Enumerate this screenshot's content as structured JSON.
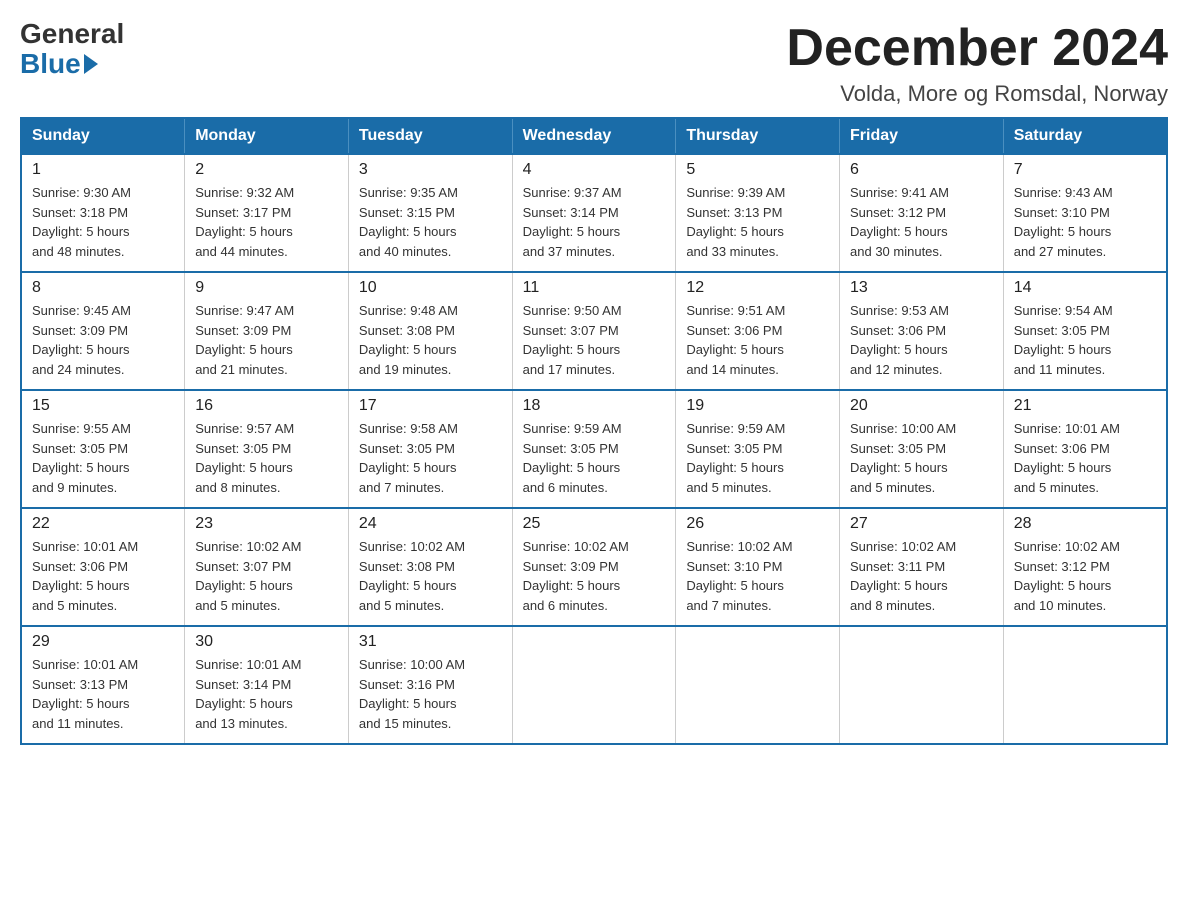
{
  "logo": {
    "general": "General",
    "blue": "Blue"
  },
  "title": "December 2024",
  "location": "Volda, More og Romsdal, Norway",
  "headers": [
    "Sunday",
    "Monday",
    "Tuesday",
    "Wednesday",
    "Thursday",
    "Friday",
    "Saturday"
  ],
  "weeks": [
    [
      {
        "day": "1",
        "info": "Sunrise: 9:30 AM\nSunset: 3:18 PM\nDaylight: 5 hours\nand 48 minutes."
      },
      {
        "day": "2",
        "info": "Sunrise: 9:32 AM\nSunset: 3:17 PM\nDaylight: 5 hours\nand 44 minutes."
      },
      {
        "day": "3",
        "info": "Sunrise: 9:35 AM\nSunset: 3:15 PM\nDaylight: 5 hours\nand 40 minutes."
      },
      {
        "day": "4",
        "info": "Sunrise: 9:37 AM\nSunset: 3:14 PM\nDaylight: 5 hours\nand 37 minutes."
      },
      {
        "day": "5",
        "info": "Sunrise: 9:39 AM\nSunset: 3:13 PM\nDaylight: 5 hours\nand 33 minutes."
      },
      {
        "day": "6",
        "info": "Sunrise: 9:41 AM\nSunset: 3:12 PM\nDaylight: 5 hours\nand 30 minutes."
      },
      {
        "day": "7",
        "info": "Sunrise: 9:43 AM\nSunset: 3:10 PM\nDaylight: 5 hours\nand 27 minutes."
      }
    ],
    [
      {
        "day": "8",
        "info": "Sunrise: 9:45 AM\nSunset: 3:09 PM\nDaylight: 5 hours\nand 24 minutes."
      },
      {
        "day": "9",
        "info": "Sunrise: 9:47 AM\nSunset: 3:09 PM\nDaylight: 5 hours\nand 21 minutes."
      },
      {
        "day": "10",
        "info": "Sunrise: 9:48 AM\nSunset: 3:08 PM\nDaylight: 5 hours\nand 19 minutes."
      },
      {
        "day": "11",
        "info": "Sunrise: 9:50 AM\nSunset: 3:07 PM\nDaylight: 5 hours\nand 17 minutes."
      },
      {
        "day": "12",
        "info": "Sunrise: 9:51 AM\nSunset: 3:06 PM\nDaylight: 5 hours\nand 14 minutes."
      },
      {
        "day": "13",
        "info": "Sunrise: 9:53 AM\nSunset: 3:06 PM\nDaylight: 5 hours\nand 12 minutes."
      },
      {
        "day": "14",
        "info": "Sunrise: 9:54 AM\nSunset: 3:05 PM\nDaylight: 5 hours\nand 11 minutes."
      }
    ],
    [
      {
        "day": "15",
        "info": "Sunrise: 9:55 AM\nSunset: 3:05 PM\nDaylight: 5 hours\nand 9 minutes."
      },
      {
        "day": "16",
        "info": "Sunrise: 9:57 AM\nSunset: 3:05 PM\nDaylight: 5 hours\nand 8 minutes."
      },
      {
        "day": "17",
        "info": "Sunrise: 9:58 AM\nSunset: 3:05 PM\nDaylight: 5 hours\nand 7 minutes."
      },
      {
        "day": "18",
        "info": "Sunrise: 9:59 AM\nSunset: 3:05 PM\nDaylight: 5 hours\nand 6 minutes."
      },
      {
        "day": "19",
        "info": "Sunrise: 9:59 AM\nSunset: 3:05 PM\nDaylight: 5 hours\nand 5 minutes."
      },
      {
        "day": "20",
        "info": "Sunrise: 10:00 AM\nSunset: 3:05 PM\nDaylight: 5 hours\nand 5 minutes."
      },
      {
        "day": "21",
        "info": "Sunrise: 10:01 AM\nSunset: 3:06 PM\nDaylight: 5 hours\nand 5 minutes."
      }
    ],
    [
      {
        "day": "22",
        "info": "Sunrise: 10:01 AM\nSunset: 3:06 PM\nDaylight: 5 hours\nand 5 minutes."
      },
      {
        "day": "23",
        "info": "Sunrise: 10:02 AM\nSunset: 3:07 PM\nDaylight: 5 hours\nand 5 minutes."
      },
      {
        "day": "24",
        "info": "Sunrise: 10:02 AM\nSunset: 3:08 PM\nDaylight: 5 hours\nand 5 minutes."
      },
      {
        "day": "25",
        "info": "Sunrise: 10:02 AM\nSunset: 3:09 PM\nDaylight: 5 hours\nand 6 minutes."
      },
      {
        "day": "26",
        "info": "Sunrise: 10:02 AM\nSunset: 3:10 PM\nDaylight: 5 hours\nand 7 minutes."
      },
      {
        "day": "27",
        "info": "Sunrise: 10:02 AM\nSunset: 3:11 PM\nDaylight: 5 hours\nand 8 minutes."
      },
      {
        "day": "28",
        "info": "Sunrise: 10:02 AM\nSunset: 3:12 PM\nDaylight: 5 hours\nand 10 minutes."
      }
    ],
    [
      {
        "day": "29",
        "info": "Sunrise: 10:01 AM\nSunset: 3:13 PM\nDaylight: 5 hours\nand 11 minutes."
      },
      {
        "day": "30",
        "info": "Sunrise: 10:01 AM\nSunset: 3:14 PM\nDaylight: 5 hours\nand 13 minutes."
      },
      {
        "day": "31",
        "info": "Sunrise: 10:00 AM\nSunset: 3:16 PM\nDaylight: 5 hours\nand 15 minutes."
      },
      {
        "day": "",
        "info": ""
      },
      {
        "day": "",
        "info": ""
      },
      {
        "day": "",
        "info": ""
      },
      {
        "day": "",
        "info": ""
      }
    ]
  ]
}
